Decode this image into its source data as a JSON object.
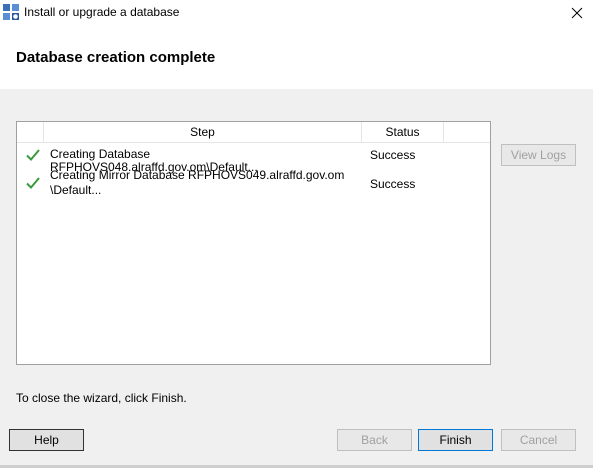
{
  "window": {
    "title": "Install or upgrade a database",
    "icon": "database-wizard-icon"
  },
  "header": {
    "title": "Database creation complete"
  },
  "grid": {
    "columns": [
      "",
      "Step",
      "Status"
    ],
    "rows": [
      {
        "icon": "green-check-icon",
        "step_line1": "Creating Database RFPHOVS048.alraffd.gov.om\\Default...",
        "step_line2": "",
        "status": "Success"
      },
      {
        "icon": "green-check-icon",
        "step_line1": "Creating Mirror Database RFPHOVS049.alraffd.gov.om",
        "step_line2": "\\Default...",
        "status": "Success"
      }
    ]
  },
  "buttons": {
    "view_logs": "View Logs",
    "help": "Help",
    "back": "Back",
    "finish": "Finish",
    "cancel": "Cancel"
  },
  "footer": {
    "instruction": "To close the wizard, click Finish."
  },
  "colors": {
    "check_green": "#3c9a3c",
    "default_button_border": "#0078d7"
  }
}
